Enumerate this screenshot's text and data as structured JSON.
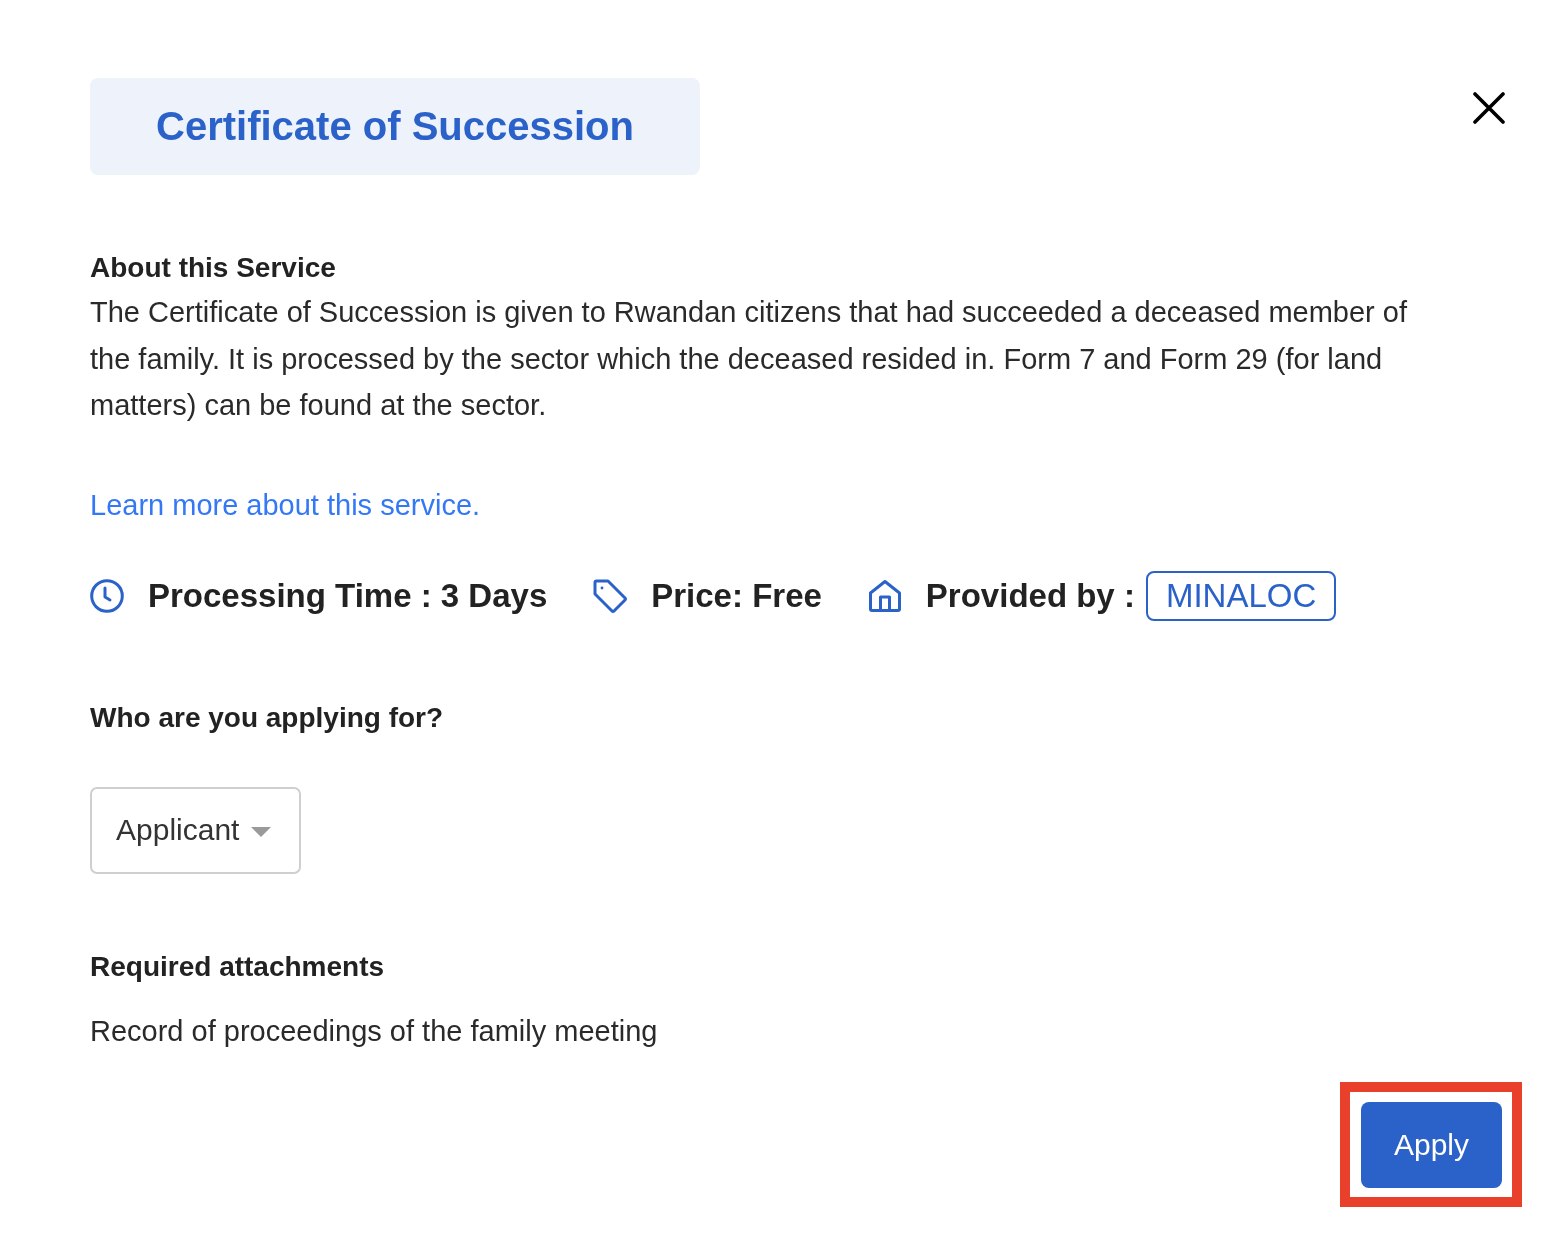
{
  "title": "Certificate of Succession",
  "about": {
    "heading": "About this Service",
    "body": "The Certificate of Succession is given to Rwandan citizens that had succeeded a deceased member of the family. It is processed by the sector which the deceased resided in. Form 7 and Form 29 (for land matters) can be found at the sector.",
    "link": "Learn more about this service."
  },
  "details": [
    {
      "kind": "time",
      "label": "Processing Time : 3 Days"
    },
    {
      "kind": "price",
      "label": "Price: Free"
    },
    {
      "kind": "provider",
      "label": "Provided by :",
      "badge": "MINALOC"
    }
  ],
  "applicant": {
    "question": "Who are you applying for?",
    "dropdown": {
      "value": "Applicant"
    }
  },
  "attachments": {
    "heading": "Required attachments",
    "items": [
      "Record of proceedings of the family meeting"
    ]
  },
  "apply_button": {
    "label": "Apply",
    "highlighted": true
  }
}
